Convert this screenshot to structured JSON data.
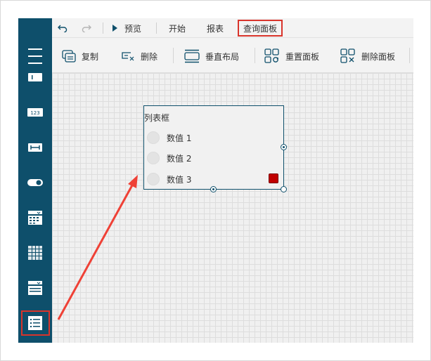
{
  "toolbar": {
    "undo_icon": "undo-icon",
    "redo_icon": "redo-icon",
    "preview": "预览",
    "tabs": [
      "开始",
      "报表",
      "查询面板"
    ],
    "active_tab": "查询面板",
    "buttons": [
      "复制",
      "删除",
      "垂直布局",
      "重置面板",
      "删除面板"
    ]
  },
  "listbox": {
    "title": "列表框",
    "items": [
      "数值 1",
      "数值 2",
      "数值 3"
    ]
  },
  "colors": {
    "sidebar": "#0e4f6b",
    "highlight": "#d9342b",
    "selected_marker": "#c00000"
  }
}
